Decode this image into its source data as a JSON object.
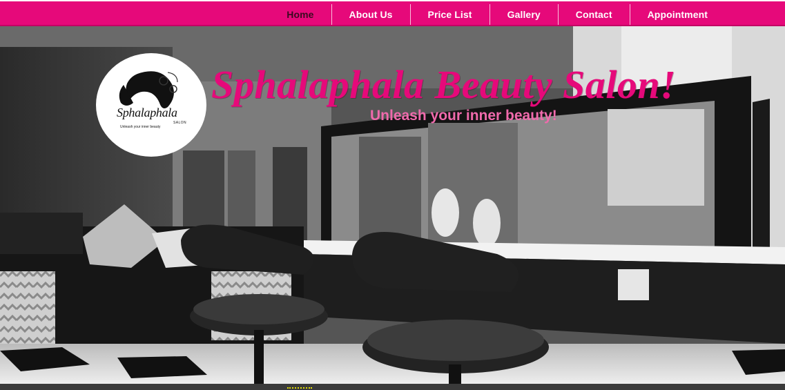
{
  "nav": {
    "items": [
      {
        "label": "Home",
        "active": true
      },
      {
        "label": "About Us"
      },
      {
        "label": "Price List"
      },
      {
        "label": "Gallery"
      },
      {
        "label": "Contact"
      },
      {
        "label": "Appointment"
      }
    ]
  },
  "logo": {
    "name": "Sphalaphala",
    "sub": "SALON",
    "tagline": "Unleash your inner beauty"
  },
  "hero": {
    "title": "Sphalaphala Beauty Salon!",
    "tagline": "Unleash your inner beauty!"
  },
  "colors": {
    "brand": "#e6097a",
    "tagline": "#f06aac"
  }
}
